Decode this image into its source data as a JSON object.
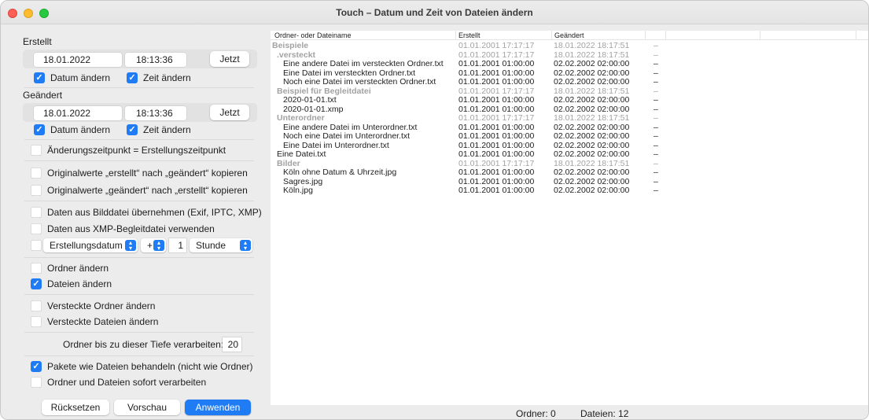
{
  "window": {
    "title": "Touch – Datum und Zeit von Dateien ändern"
  },
  "created": {
    "label": "Erstellt",
    "date": "18.01.2022",
    "time": "18:13:36",
    "now_button": "Jetzt",
    "change_date": {
      "label": "Datum ändern",
      "checked": true
    },
    "change_time": {
      "label": "Zeit ändern",
      "checked": true
    }
  },
  "modified": {
    "label": "Geändert",
    "date": "18.01.2022",
    "time": "18:13:36",
    "now_button": "Jetzt",
    "change_date": {
      "label": "Datum ändern",
      "checked": true
    },
    "change_time": {
      "label": "Zeit ändern",
      "checked": true
    }
  },
  "options": {
    "same_time": {
      "label": "Änderungszeitpunkt = Erstellungszeitpunkt",
      "checked": false
    },
    "copy_created_to_modified": {
      "label": "Originalwerte „erstellt“ nach „geändert“ kopieren",
      "checked": false
    },
    "copy_modified_to_created": {
      "label": "Originalwerte „geändert“ nach „erstellt“ kopieren",
      "checked": false
    },
    "from_image": {
      "label": "Daten aus Bilddatei übernehmen (Exif, IPTC, XMP)",
      "checked": false
    },
    "from_xmp": {
      "label": "Daten aus XMP-Begleitdatei verwenden",
      "checked": false
    },
    "offset": {
      "checked": false,
      "field_select": "Erstellungsdatum",
      "sign_select": "+",
      "amount": "1",
      "unit_select": "Stunde"
    },
    "change_folders": {
      "label": "Ordner ändern",
      "checked": false
    },
    "change_files": {
      "label": "Dateien ändern",
      "checked": true
    },
    "change_hidden_folders": {
      "label": "Versteckte Ordner ändern",
      "checked": false
    },
    "change_hidden_files": {
      "label": "Versteckte Dateien ändern",
      "checked": false
    },
    "depth": {
      "label": "Ordner bis zu dieser Tiefe verarbeiten:",
      "value": "20"
    },
    "packages_as_files": {
      "label": "Pakete wie Dateien behandeln (nicht wie Ordner)",
      "checked": true
    },
    "process_immediately": {
      "label": "Ordner und Dateien sofort verarbeiten",
      "checked": false
    }
  },
  "buttons": {
    "reset": "Rücksetzen",
    "preview": "Vorschau",
    "apply": "Anwenden"
  },
  "table": {
    "columns": [
      "Ordner- oder Dateiname",
      "Erstellt",
      "Geändert"
    ],
    "rows": [
      {
        "name": "Beispiele",
        "created": "01.01.2001  17:17:17",
        "modified": "18.01.2022  18:17:51",
        "extra": "–",
        "grey": true,
        "group": true
      },
      {
        "name": ".versteckt",
        "created": "01.01.2001  17:17:17",
        "modified": "18.01.2022  18:17:51",
        "extra": "–",
        "grey": true,
        "group": true
      },
      {
        "name": "Eine andere Datei im versteckten Ordner.txt",
        "created": "01.01.2001  01:00:00",
        "modified": "02.02.2002  02:00:00",
        "extra": "–",
        "grey": false,
        "group": false
      },
      {
        "name": "Eine Datei im versteckten Ordner.txt",
        "created": "01.01.2001  01:00:00",
        "modified": "02.02.2002  02:00:00",
        "extra": "–",
        "grey": false,
        "group": false
      },
      {
        "name": "Noch eine Datei im versteckten Ordner.txt",
        "created": "01.01.2001  01:00:00",
        "modified": "02.02.2002  02:00:00",
        "extra": "–",
        "grey": false,
        "group": false
      },
      {
        "name": "Beispiel für Begleitdatei",
        "created": "01.01.2001  17:17:17",
        "modified": "18.01.2022  18:17:51",
        "extra": "–",
        "grey": true,
        "group": true
      },
      {
        "name": "2020-01-01.txt",
        "created": "01.01.2001  01:00:00",
        "modified": "02.02.2002  02:00:00",
        "extra": "–",
        "grey": false,
        "group": false
      },
      {
        "name": "2020-01-01.xmp",
        "created": "01.01.2001  01:00:00",
        "modified": "02.02.2002  02:00:00",
        "extra": "–",
        "grey": false,
        "group": false
      },
      {
        "name": "Unterordner",
        "created": "01.01.2001  17:17:17",
        "modified": "18.01.2022  18:17:51",
        "extra": "–",
        "grey": true,
        "group": true
      },
      {
        "name": "Eine andere Datei im Unterordner.txt",
        "created": "01.01.2001  01:00:00",
        "modified": "02.02.2002  02:00:00",
        "extra": "–",
        "grey": false,
        "group": false
      },
      {
        "name": "Noch eine Datei im Unterordner.txt",
        "created": "01.01.2001  01:00:00",
        "modified": "02.02.2002  02:00:00",
        "extra": "–",
        "grey": false,
        "group": false
      },
      {
        "name": "Eine Datei im Unterordner.txt",
        "created": "01.01.2001  01:00:00",
        "modified": "02.02.2002  02:00:00",
        "extra": "–",
        "grey": false,
        "group": false
      },
      {
        "name": "Eine Datei.txt",
        "created": "01.01.2001  01:00:00",
        "modified": "02.02.2002  02:00:00",
        "extra": "–",
        "grey": false,
        "group": false
      },
      {
        "name": "Bilder",
        "created": "01.01.2001  17:17:17",
        "modified": "18.01.2022  18:17:51",
        "extra": "–",
        "grey": true,
        "group": true
      },
      {
        "name": "Köln ohne Datum & Uhrzeit.jpg",
        "created": "01.01.2001  01:00:00",
        "modified": "02.02.2002  02:00:00",
        "extra": "–",
        "grey": false,
        "group": false
      },
      {
        "name": "Sagres.jpg",
        "created": "01.01.2001  01:00:00",
        "modified": "02.02.2002  02:00:00",
        "extra": "–",
        "grey": false,
        "group": false
      },
      {
        "name": "Köln.jpg",
        "created": "01.01.2001  01:00:00",
        "modified": "02.02.2002  02:00:00",
        "extra": "–",
        "grey": false,
        "group": false
      }
    ]
  },
  "status": {
    "folders": "Ordner: 0",
    "files": "Dateien: 12"
  },
  "colors": {
    "accent": "#1f7cf5",
    "group_text": "#a2a2a2"
  }
}
